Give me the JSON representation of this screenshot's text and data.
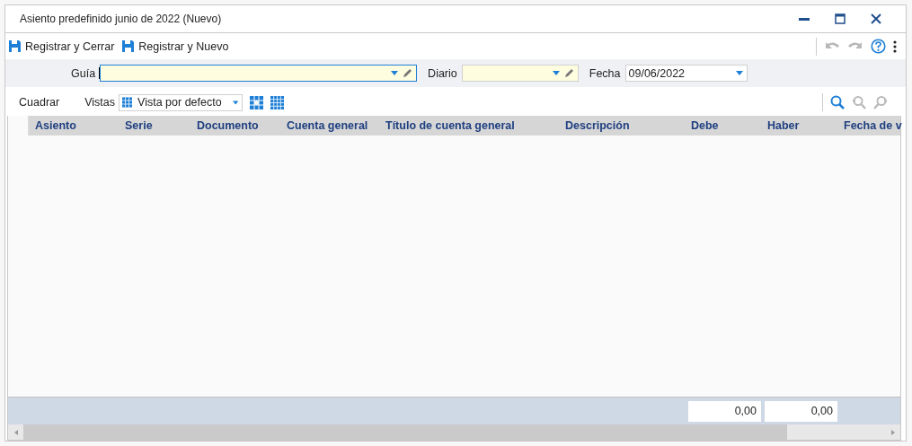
{
  "window": {
    "title": "Asiento predefinido junio de 2022 (Nuevo)"
  },
  "toolbar": {
    "buttons": [
      {
        "label": "Registrar y Cerrar"
      },
      {
        "label": "Registrar y Nuevo"
      }
    ]
  },
  "filters": [
    {
      "label": "Guía",
      "focused": true,
      "kind": "lookup"
    },
    {
      "label": "Diario",
      "focused": false,
      "kind": "lookup"
    },
    {
      "label": "Fecha",
      "value": "09/06/2022",
      "focused": false,
      "kind": "date"
    }
  ],
  "grid_toolbar": {
    "action": "Cuadrar",
    "views_label": "Vistas",
    "view": "Vista por defecto"
  },
  "table": {
    "columns": [
      "Asiento",
      "Serie",
      "Documento",
      "Cuenta general",
      "Título de cuenta general",
      "Descripción",
      "Debe",
      "Haber",
      "Fecha de v"
    ]
  },
  "totals": [
    "0,00",
    "0,00"
  ]
}
